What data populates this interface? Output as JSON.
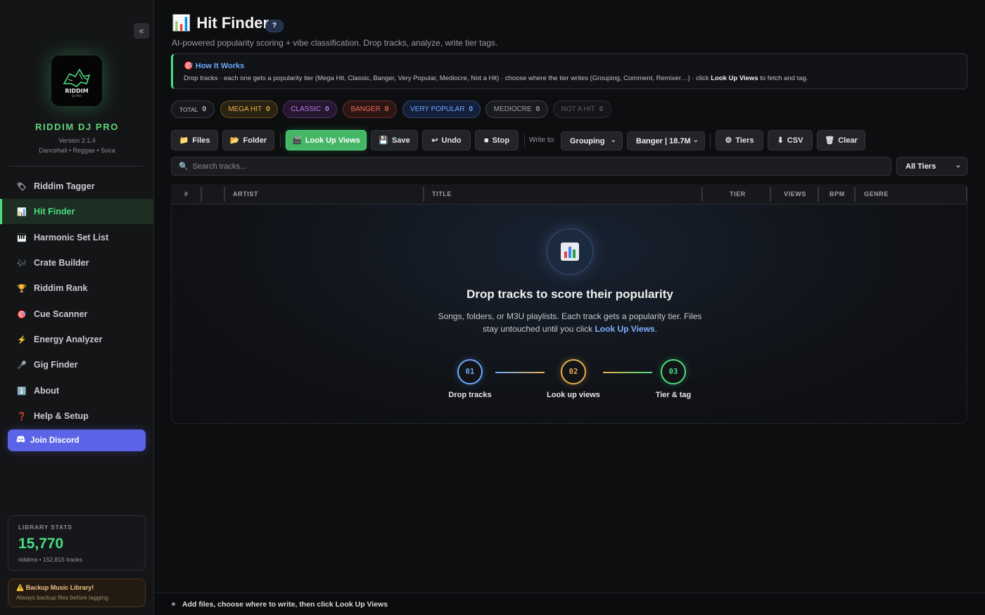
{
  "sidebar": {
    "collapse_label": "«",
    "brand_name": "RIDDIM DJ PRO",
    "logo_text": "RIDDIM",
    "logo_subtext": "DJ PRO",
    "version": "Version 2.1.4",
    "genres": "Dancehall • Reggae • Soca",
    "nav": [
      {
        "label": "Riddim Tagger",
        "icon": "tag-icon",
        "glyph": "🏷"
      },
      {
        "label": "Hit Finder",
        "icon": "bar-chart-icon",
        "glyph": "📊"
      },
      {
        "label": "Harmonic Set List",
        "icon": "piano-icon",
        "glyph": "🎹"
      },
      {
        "label": "Crate Builder",
        "icon": "music-notes-icon",
        "glyph": "🎶"
      },
      {
        "label": "Riddim Rank",
        "icon": "trophy-icon",
        "glyph": "🏆"
      },
      {
        "label": "Cue Scanner",
        "icon": "target-icon",
        "glyph": "🎯"
      },
      {
        "label": "Energy Analyzer",
        "icon": "lightning-icon",
        "glyph": "⚡"
      },
      {
        "label": "Gig Finder",
        "icon": "microphone-icon",
        "glyph": "🎤"
      },
      {
        "label": "About",
        "icon": "info-icon",
        "glyph": "ℹ️"
      },
      {
        "label": "Help & Setup",
        "icon": "question-icon",
        "glyph": "❓"
      }
    ],
    "active_nav": "Hit Finder",
    "discord_label": "Join Discord",
    "stats": {
      "label": "LIBRARY STATS",
      "number": "15,770",
      "sub": "riddims • 152,815 tracks"
    },
    "backup": {
      "title": "Backup Music Library!",
      "sub": "Always backup files before tagging"
    }
  },
  "header": {
    "title": "Hit Finder",
    "title_icon": "📊",
    "help_label": "?",
    "subtitle": "AI-powered popularity scoring + vibe classification. Drop tracks, analyze, write tier tags."
  },
  "how_it_works": {
    "title": "How It Works",
    "text_before": "Drop tracks · each one gets a popularity tier (Mega Hit, Classic, Banger, Very Popular, Mediocre, Not a Hit) · choose where the tier writes (Grouping, Comment, Remixer…) · click ",
    "text_bold": "Look Up Views",
    "text_after": " to fetch and tag."
  },
  "tier_counts": [
    {
      "label": "TOTAL",
      "count": "0",
      "color": "#c0c2c6"
    },
    {
      "label": "MEGA HIT",
      "count": "0",
      "color": "#e8b04a"
    },
    {
      "label": "CLASSIC",
      "count": "0",
      "color": "#c07bf0"
    },
    {
      "label": "BANGER",
      "count": "0",
      "color": "#f06a5a"
    },
    {
      "label": "VERY POPULAR",
      "count": "0",
      "color": "#6ea8ff"
    },
    {
      "label": "MEDIOCRE",
      "count": "0",
      "color": "#a0a2a6"
    },
    {
      "label": "NOT A HIT",
      "count": "0",
      "color": "#5c5e62"
    }
  ],
  "toolbar": {
    "files": "Files",
    "folder": "Folder",
    "lookup": "Look Up Views",
    "save": "Save",
    "undo": "Undo",
    "stop": "Stop",
    "write_to_label": "Write to:",
    "write_to_value": "Grouping",
    "format_value": "Banger | 18.7M",
    "tiers": "Tiers",
    "csv": "CSV",
    "clear": "Clear"
  },
  "search": {
    "placeholder": "Search tracks...",
    "tier_filter": "All Tiers"
  },
  "table": {
    "columns": [
      "#",
      "ARTIST",
      "TITLE",
      "TIER",
      "VIEWS",
      "BPM",
      "GENRE"
    ]
  },
  "empty_state": {
    "title": "Drop tracks to score their popularity",
    "desc_before": "Songs, folders, or M3U playlists. Each track gets a popularity tier. Files stay untouched until you click ",
    "desc_link": "Look Up Views",
    "desc_after": ".",
    "steps": [
      {
        "num": "01",
        "label": "Drop tracks",
        "color": "#6ea8ff"
      },
      {
        "num": "02",
        "label": "Look up views",
        "color": "#e8b04a"
      },
      {
        "num": "03",
        "label": "Tier & tag",
        "color": "#4ade80"
      }
    ]
  },
  "status": {
    "text": "Add files, choose where to write, then click Look Up Views"
  }
}
